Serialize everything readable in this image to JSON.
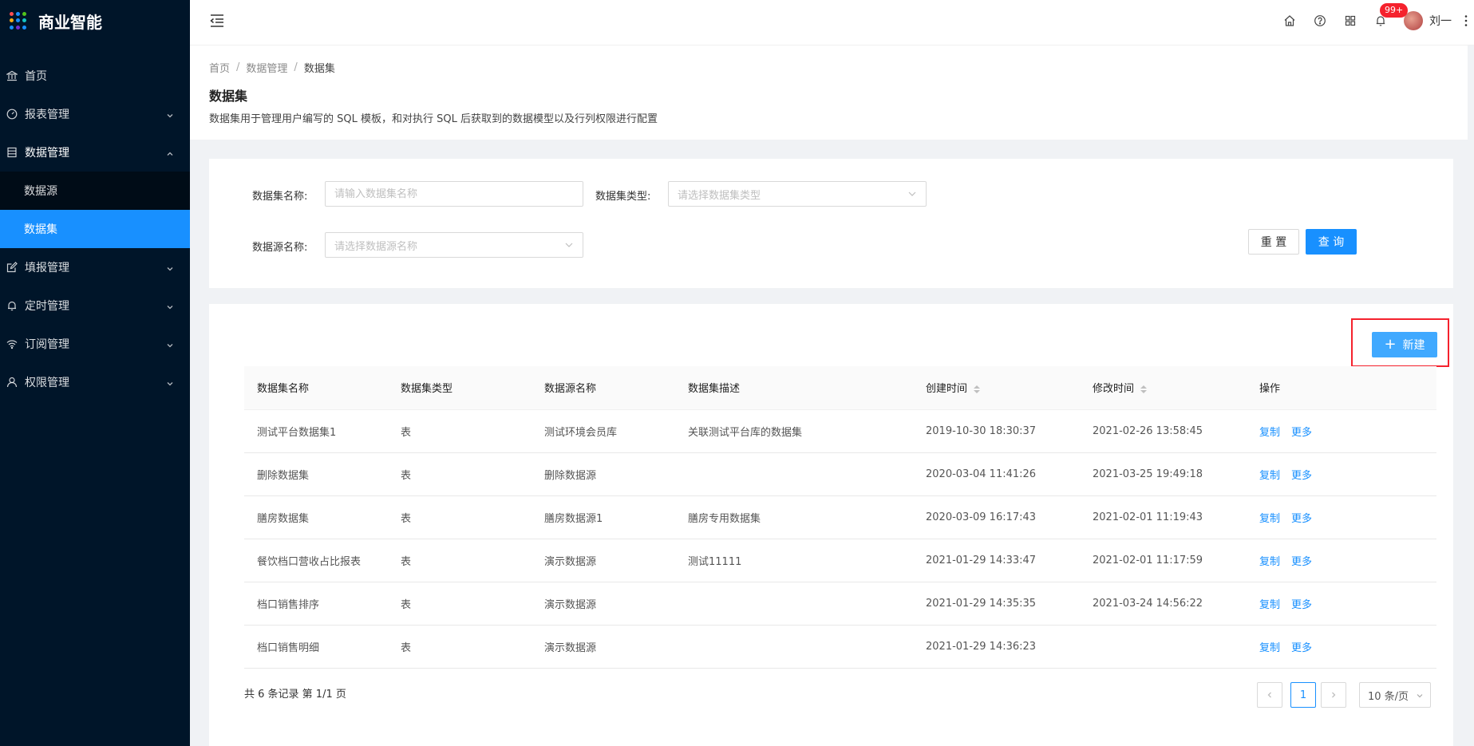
{
  "app": {
    "title": "商业智能"
  },
  "sidebar": {
    "items": [
      {
        "label": "首页",
        "icon": "home-icon",
        "has_arrow": false
      },
      {
        "label": "报表管理",
        "icon": "dashboard-icon",
        "has_arrow": true
      },
      {
        "label": "数据管理",
        "icon": "database-icon",
        "has_arrow": true,
        "open": true,
        "children": [
          {
            "label": "数据源",
            "active": false
          },
          {
            "label": "数据集",
            "active": true
          }
        ]
      },
      {
        "label": "填报管理",
        "icon": "form-edit-icon",
        "has_arrow": true
      },
      {
        "label": "定时管理",
        "icon": "bell-icon",
        "has_arrow": true
      },
      {
        "label": "订阅管理",
        "icon": "wifi-icon",
        "has_arrow": true
      },
      {
        "label": "权限管理",
        "icon": "user-icon",
        "has_arrow": true
      }
    ]
  },
  "header": {
    "notification_badge": "99+",
    "user_name": "刘一"
  },
  "page": {
    "breadcrumb": [
      "首页",
      "数据管理",
      "数据集"
    ],
    "title": "数据集",
    "description": "数据集用于管理用户编写的 SQL 模板，和对执行 SQL 后获取到的数据模型以及行列权限进行配置"
  },
  "filters": {
    "name_label": "数据集名称:",
    "name_placeholder": "请输入数据集名称",
    "type_label": "数据集类型:",
    "type_placeholder": "请选择数据集类型",
    "source_label": "数据源名称:",
    "source_placeholder": "请选择数据源名称",
    "reset_label": "重 置",
    "query_label": "查 询"
  },
  "toolbar": {
    "new_label": "新建"
  },
  "table": {
    "columns": [
      "数据集名称",
      "数据集类型",
      "数据源名称",
      "数据集描述",
      "创建时间",
      "修改时间",
      "操作"
    ],
    "rows": [
      {
        "name": "测试平台数据集1",
        "type": "表",
        "source": "测试环境会员库",
        "desc": "关联测试平台库的数据集",
        "created": "2019-10-30 18:30:37",
        "modified": "2021-02-26 13:58:45"
      },
      {
        "name": "删除数据集",
        "type": "表",
        "source": "删除数据源",
        "desc": "",
        "created": "2020-03-04 11:41:26",
        "modified": "2021-03-25 19:49:18"
      },
      {
        "name": "膳房数据集",
        "type": "表",
        "source": "膳房数据源1",
        "desc": "膳房专用数据集",
        "created": "2020-03-09 16:17:43",
        "modified": "2021-02-01 11:19:43"
      },
      {
        "name": "餐饮档口营收占比报表",
        "type": "表",
        "source": "演示数据源",
        "desc": "测试11111",
        "created": "2021-01-29 14:33:47",
        "modified": "2021-02-01 11:17:59"
      },
      {
        "name": "档口销售排序",
        "type": "表",
        "source": "演示数据源",
        "desc": "",
        "created": "2021-01-29 14:35:35",
        "modified": "2021-03-24 14:56:22"
      },
      {
        "name": "档口销售明细",
        "type": "表",
        "source": "演示数据源",
        "desc": "",
        "created": "2021-01-29 14:36:23",
        "modified": ""
      }
    ],
    "action_copy": "复制",
    "action_more": "更多"
  },
  "pagination": {
    "summary": "共 6 条记录 第 1/1 页",
    "current_page": "1",
    "page_size": "10 条/页"
  },
  "colors": {
    "primary": "#1890ff",
    "sidebar_bg": "#001529",
    "highlight": "#f5222d"
  }
}
